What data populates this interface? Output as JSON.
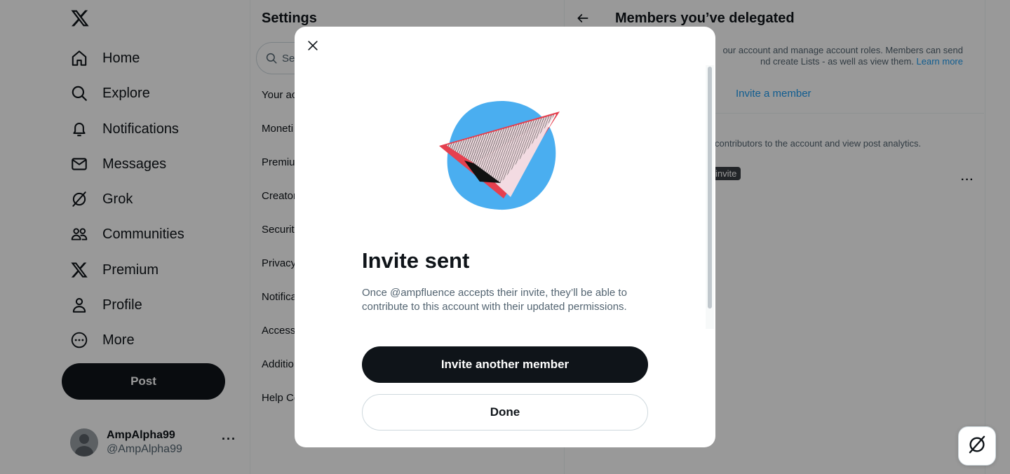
{
  "nav": {
    "items": [
      {
        "label": "Home",
        "icon": "home-icon"
      },
      {
        "label": "Explore",
        "icon": "search-icon"
      },
      {
        "label": "Notifications",
        "icon": "bell-icon"
      },
      {
        "label": "Messages",
        "icon": "mail-icon"
      },
      {
        "label": "Grok",
        "icon": "grok-icon"
      },
      {
        "label": "Communities",
        "icon": "communities-icon"
      },
      {
        "label": "Premium",
        "icon": "x-logo-icon"
      },
      {
        "label": "Profile",
        "icon": "person-icon"
      },
      {
        "label": "More",
        "icon": "more-circle-icon"
      }
    ],
    "post_label": "Post"
  },
  "account": {
    "name": "AmpAlpha99",
    "handle": "@AmpAlpha99",
    "more": "···"
  },
  "settings": {
    "title": "Settings",
    "search_placeholder": "Sea",
    "items": [
      "Your ac",
      "Moneti",
      "Premiu",
      "Creator",
      "Securit",
      "Privacy",
      "Notifica",
      "Access",
      "Additio",
      "Help Ce"
    ]
  },
  "detail": {
    "title": "Members you’ve delegated",
    "desc_line1": "our account and manage account roles. Members can send",
    "desc_line2": "nd create Lists - as well as view them.",
    "learn_more": "Learn more",
    "invite_link": "Invite a member",
    "desc2": "contributors to the account and view post analytics.",
    "badge": "invite",
    "row_more": "···"
  },
  "modal": {
    "heading": "Invite sent",
    "body": "Once @ampfluence accepts their invite, they’ll be able to contribute to this account with their updated permissions.",
    "primary_button": "Invite another member",
    "secondary_button": "Done"
  },
  "colors": {
    "brand_blue": "#1d9bf0",
    "illustration_blue": "#4aaef0",
    "illustration_red": "#e5404f",
    "dark": "#0f1419",
    "muted": "#536471"
  }
}
